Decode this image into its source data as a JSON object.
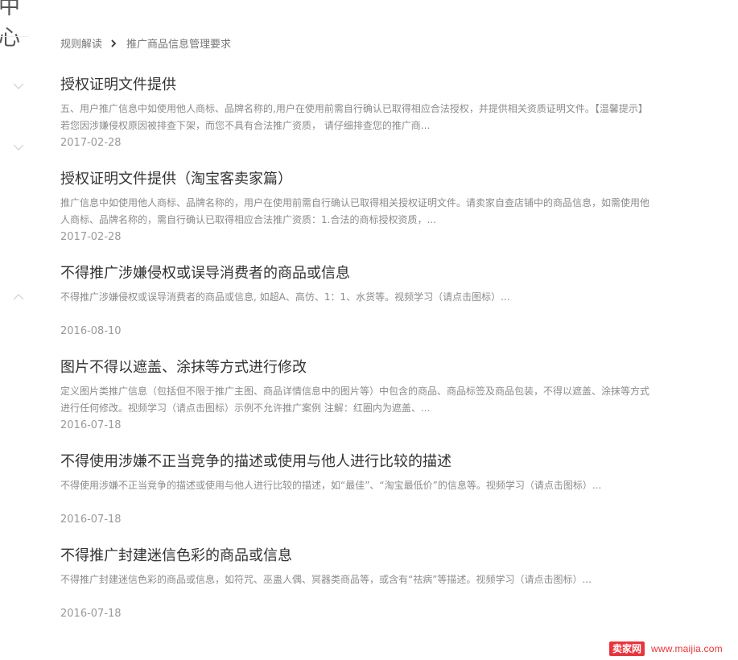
{
  "sidebar": {
    "title": "中心"
  },
  "breadcrumb": {
    "parent": "规则解读",
    "current": "推广商品信息管理要求"
  },
  "articles": [
    {
      "title": "授权证明文件提供",
      "summary": "五、用户推广信息中如使用他人商标、品牌名称的,用户在使用前需自行确认已取得相应合法授权，并提供相关资质证明文件。【温馨提示】若您因涉嫌侵权原因被排查下架，而您不具有合法推广资质， 请仔细排查您的推广商...",
      "date": "2017-02-28"
    },
    {
      "title": "授权证明文件提供（淘宝客卖家篇）",
      "summary": "推广信息中如使用他人商标、品牌名称的，用户在使用前需自行确认已取得相关授权证明文件。请卖家自查店铺中的商品信息，如需使用他人商标、品牌名称的，需自行确认已取得相应合法推广资质：1.合法的商标授权资质，...",
      "date": "2017-02-28"
    },
    {
      "title": "不得推广涉嫌侵权或误导消费者的商品或信息",
      "summary": "不得推广涉嫌侵权或误导消费者的商品或信息, 如超A、高仿、1：1、水货等。视频学习（请点击图标）...",
      "date": "2016-08-10"
    },
    {
      "title": "图片不得以遮盖、涂抹等方式进行修改",
      "summary": "定义图片类推广信息（包括但不限于推广主图、商品详情信息中的图片等）中包含的商品、商品标签及商品包装，不得以遮盖、涂抹等方式进行任何修改。视频学习（请点击图标）示例不允许推广案例 注解：红圈内为遮盖、...",
      "date": "2016-07-18"
    },
    {
      "title": "不得使用涉嫌不正当竞争的描述或使用与他人进行比较的描述",
      "summary": "不得使用涉嫌不正当竞争的描述或使用与他人进行比较的描述，如“最佳”、“淘宝最低价”的信息等。视频学习（请点击图标）...",
      "date": "2016-07-18"
    },
    {
      "title": "不得推广封建迷信色彩的商品或信息",
      "summary": "不得推广封建迷信色彩的商品或信息，如符咒、巫蛊人偶、冥器类商品等，或含有“祛病”等描述。视频学习（请点击图标）...",
      "date": "2016-07-18"
    }
  ],
  "watermark": {
    "badge": "卖家网",
    "url": "www.maijia.com"
  },
  "icons": {
    "breadcrumb_separator": "chevron-right-icon",
    "sidebar_toggles": [
      "chevron-down-icon",
      "chevron-down-icon",
      "chevron-up-icon"
    ]
  },
  "colors": {
    "title_text": "#333333",
    "summary_text": "#8c8c8c",
    "date_text": "#999999",
    "watermark_red": "#e9343c"
  }
}
